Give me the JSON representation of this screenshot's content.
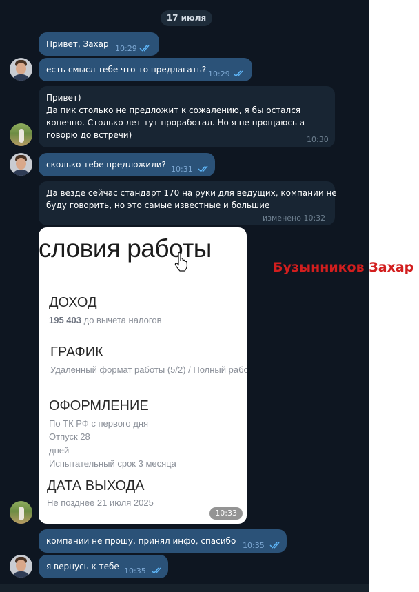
{
  "date_label": "17 июля",
  "messages": [
    {
      "text": "Привет, Захар",
      "time": "10:29"
    },
    {
      "text": "есть смысл тебе что-то предлагать?",
      "time": "10:29"
    },
    {
      "lines": [
        "Привет)",
        "Да пик столько не предложит к сожалению, я бы остался",
        "конечно. Столько лет тут проработал. Но я не прощаюсь а",
        "говорю до встречи)"
      ],
      "time": "10:30"
    },
    {
      "text": "сколько тебе предложили?",
      "time": "10:31"
    },
    {
      "lines": [
        "Да везде сейчас стандарт 170 на руки для ведущих, компании не",
        "буду говорить, но это самые известные и большие"
      ],
      "time": "изменено 10:32"
    },
    {
      "text": "компании не прошу, принял инфо, спасибо",
      "time": "10:35"
    },
    {
      "text": "я вернусь к тебе",
      "time": "10:35"
    }
  ],
  "image_card": {
    "title": "словия работы",
    "income_heading": "ДОХОД",
    "income_amount": "195 403",
    "income_note": "до вычета налогов",
    "schedule_heading": "ГРАФИК",
    "schedule_text": "Удаленный формат работы (5/2) / Полный рабо",
    "registration_heading": "ОФОРМЛЕНИЕ",
    "registration_lines": [
      "По ТК РФ с первого дня",
      "Отпуск 28",
      "дней",
      "Испытательный срок 3 месяца"
    ],
    "start_heading": "ДАТА ВЫХОДА",
    "start_text": "Не позднее 21 июля 2025",
    "time": "10:33"
  },
  "overlay_name": "Бузынников Захар",
  "icons": {
    "read": "double-check-icon",
    "cursor": "hand-pointer-icon"
  },
  "colors": {
    "chat_bg": "#0e1621",
    "outgoing_bubble": "#2b5278",
    "incoming_bubble": "#182533",
    "read_ticks": "#5eb5f7",
    "overlay_name": "#d21e1e"
  }
}
